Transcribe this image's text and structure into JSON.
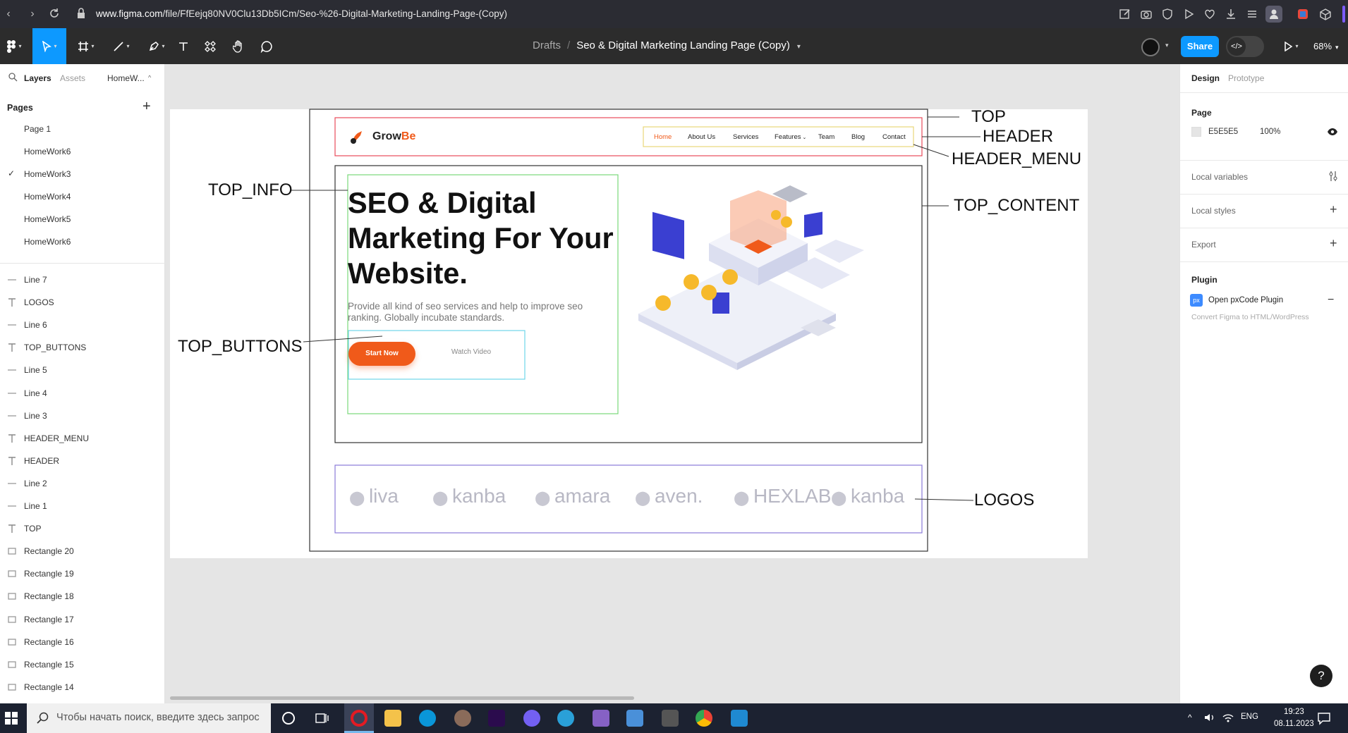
{
  "browser": {
    "url_domain": "www.figma.com",
    "url_path": "/file/FfEejq80NV0Clu13Db5ICm/Seo-%26-Digital-Marketing-Landing-Page-(Copy)"
  },
  "toolbar": {
    "breadcrumb_root": "Drafts",
    "breadcrumb_sep": "/",
    "file_name": "Seo & Digital Marketing Landing Page (Copy)",
    "share_label": "Share",
    "zoom": "68%",
    "dev_mode_icon": "</>"
  },
  "left_panel": {
    "tabs": [
      "Layers",
      "Assets",
      "HomeW..."
    ],
    "pages_header": "Pages",
    "pages": [
      {
        "label": "Page 1",
        "checked": false
      },
      {
        "label": "HomeWork6",
        "checked": false
      },
      {
        "label": "HomeWork3",
        "checked": true
      },
      {
        "label": "HomeWork4",
        "checked": false
      },
      {
        "label": "HomeWork5",
        "checked": false
      },
      {
        "label": "HomeWork6",
        "checked": false
      }
    ],
    "layers": [
      {
        "label": "Line 7",
        "icon": "line-icon"
      },
      {
        "label": "LOGOS",
        "icon": "text-icon"
      },
      {
        "label": "Line 6",
        "icon": "line-icon"
      },
      {
        "label": "TOP_BUTTONS",
        "icon": "text-icon"
      },
      {
        "label": "Line 5",
        "icon": "line-icon"
      },
      {
        "label": "Line 4",
        "icon": "line-icon"
      },
      {
        "label": "Line 3",
        "icon": "line-icon"
      },
      {
        "label": "HEADER_MENU",
        "icon": "text-icon"
      },
      {
        "label": "HEADER",
        "icon": "text-icon"
      },
      {
        "label": "Line 2",
        "icon": "line-icon"
      },
      {
        "label": "Line 1",
        "icon": "line-icon"
      },
      {
        "label": "TOP",
        "icon": "text-icon"
      },
      {
        "label": "Rectangle 20",
        "icon": "rect-icon"
      },
      {
        "label": "Rectangle 19",
        "icon": "rect-icon"
      },
      {
        "label": "Rectangle 18",
        "icon": "rect-icon"
      },
      {
        "label": "Rectangle 17",
        "icon": "rect-icon"
      },
      {
        "label": "Rectangle 16",
        "icon": "rect-icon"
      },
      {
        "label": "Rectangle 15",
        "icon": "rect-icon"
      },
      {
        "label": "Rectangle 14",
        "icon": "rect-icon"
      }
    ]
  },
  "right_panel": {
    "tabs": [
      "Design",
      "Prototype"
    ],
    "page_header": "Page",
    "page_color": "E5E5E5",
    "page_opacity": "100%",
    "local_variables": "Local variables",
    "local_styles": "Local styles",
    "export": "Export",
    "plugin_header": "Plugin",
    "plugin_name": "Open pxCode Plugin",
    "plugin_desc": "Convert Figma to HTML/WordPress",
    "plugin_badge": "px",
    "help": "?"
  },
  "landing": {
    "brand_prefix": "Grow",
    "brand_suffix": "Be",
    "menu": [
      "Home",
      "About Us",
      "Services",
      "Features",
      "Team",
      "Blog",
      "Contact"
    ],
    "hero_title": "SEO & Digital Marketing For Your Website.",
    "hero_sub": "Provide all kind of seo services and help to improve seo ranking. Globally incubate standards.",
    "btn_start": "Start Now",
    "btn_watch": "Watch Video",
    "logos": [
      "liva",
      "kanba",
      "amara",
      "aven.",
      "HEXLAB",
      "kanba"
    ]
  },
  "annotations": {
    "top": "TOP",
    "header": "HEADER",
    "header_menu": "HEADER_MENU",
    "top_info": "TOP_INFO",
    "top_content": "TOP_CONTENT",
    "top_buttons": "TOP_BUTTONS",
    "logos": "LOGOS"
  },
  "taskbar": {
    "search_placeholder": "Чтобы начать поиск, введите здесь запрос",
    "lang": "ENG",
    "time": "19:23",
    "date": "08.11.2023"
  },
  "colors": {
    "accent": "#0d99ff",
    "brand_orange": "#f05a1a",
    "frame_top": "#333333",
    "frame_header": "#e94b5a",
    "frame_menu": "#e8d77a",
    "frame_info": "#7ad87a",
    "frame_buttons": "#6fd6e8",
    "frame_logos": "#8a7ad8"
  }
}
